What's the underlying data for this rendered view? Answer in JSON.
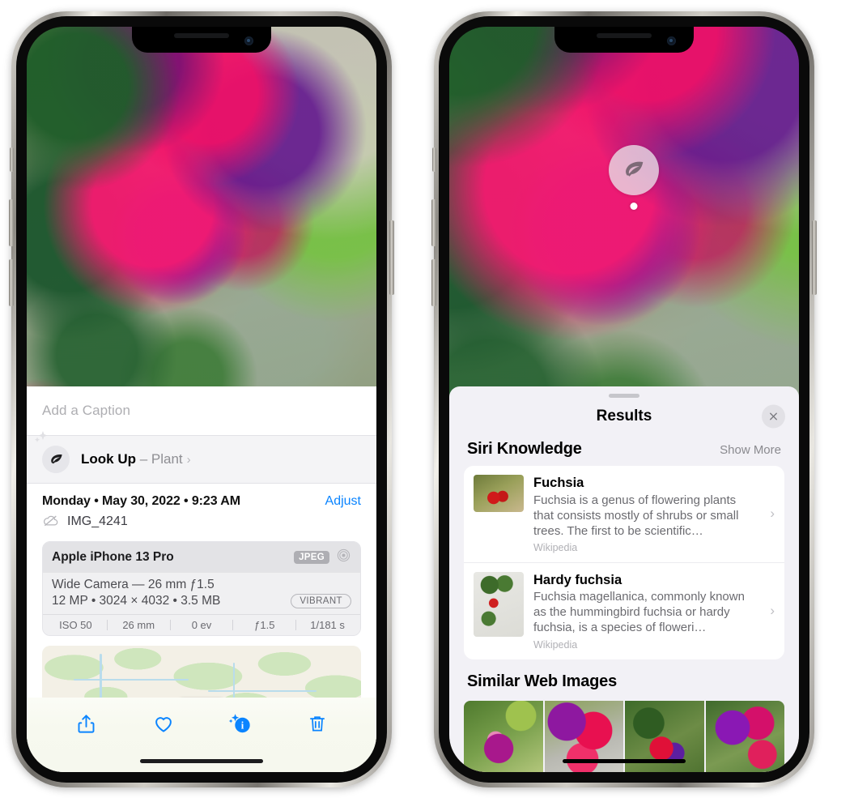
{
  "left_phone": {
    "caption": {
      "placeholder": "Add a Caption",
      "value": ""
    },
    "look_up": {
      "label": "Look Up",
      "dash": " – ",
      "subject": "Plant",
      "chevron": "›"
    },
    "metadata": {
      "date_line": "Monday • May 30, 2022 • 9:23 AM",
      "adjust_label": "Adjust",
      "file_name": "IMG_4241"
    },
    "exif": {
      "device": "Apple iPhone 13 Pro",
      "format_badge": "JPEG",
      "lens_line": "Wide Camera — 26 mm ƒ1.5",
      "size_line": "12 MP • 3024 × 4032 • 3.5 MB",
      "profile_chip": "VIBRANT",
      "stats": [
        {
          "label": "ISO 50"
        },
        {
          "label": "26 mm"
        },
        {
          "label": "0 ev"
        },
        {
          "label": "ƒ1.5"
        },
        {
          "label": "1/181 s"
        }
      ]
    },
    "toolbar": [
      {
        "name": "share-button",
        "icon": "share-icon"
      },
      {
        "name": "favorite-button",
        "icon": "heart-icon"
      },
      {
        "name": "info-button",
        "icon": "info-sparkle-icon"
      },
      {
        "name": "delete-button",
        "icon": "trash-icon"
      }
    ]
  },
  "right_phone": {
    "badge": {
      "icon": "leaf-icon"
    },
    "sheet": {
      "title": "Results",
      "close_label": "✕"
    },
    "siri_knowledge": {
      "title": "Siri Knowledge",
      "action": "Show More",
      "items": [
        {
          "title": "Fuchsia",
          "description": "Fuchsia is a genus of flowering plants that consists mostly of shrubs or small trees. The first to be scientific…",
          "source": "Wikipedia",
          "chevron": "›"
        },
        {
          "title": "Hardy fuchsia",
          "description": "Fuchsia magellanica, commonly known as the hummingbird fuchsia or hardy fuchsia, is a species of floweri…",
          "source": "Wikipedia",
          "chevron": "›"
        }
      ]
    },
    "similar_web_images": {
      "title": "Similar Web Images",
      "count": 4
    }
  },
  "colors": {
    "accent_blue": "#0a84ff",
    "sheet_background": "#f2f1f6",
    "card_white": "#ffffff",
    "secondary_text": "#8e8e93",
    "exif_card": "#f0f0f2"
  }
}
